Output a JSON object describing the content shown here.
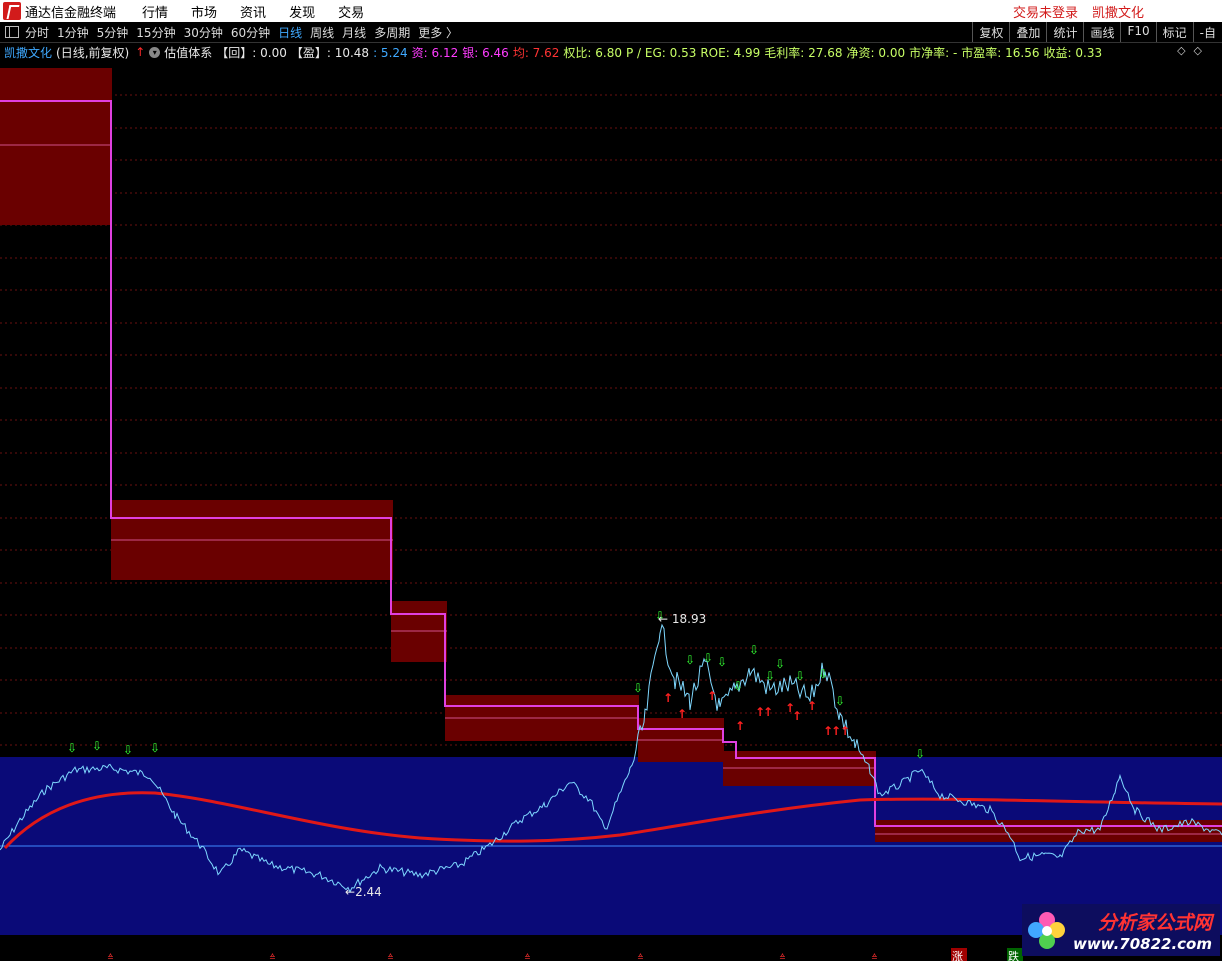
{
  "titlebar": {
    "app_title": "通达信金融终端",
    "menu": [
      "行情",
      "市场",
      "资讯",
      "发现",
      "交易"
    ],
    "login_status": "交易未登录",
    "stock": "凯撒文化"
  },
  "toolbar": {
    "periods": [
      "分时",
      "1分钟",
      "5分钟",
      "15分钟",
      "30分钟",
      "60分钟",
      "日线",
      "周线",
      "月线",
      "多周期",
      "更多 〉"
    ],
    "active_period": "日线",
    "right_buttons": [
      "复权",
      "叠加",
      "统计",
      "画线",
      "F10",
      "标记",
      "-自"
    ]
  },
  "infobar": {
    "stock_name": "凯撒文化",
    "mode": "(日线,前复权)",
    "indicator": "估值体系",
    "items": [
      {
        "label": "【回】: 0.00",
        "color": "#e8e8e8"
      },
      {
        "label": "【盈】: 10.48",
        "color": "#e8e8e8"
      },
      {
        "label": ": 5.24",
        "color": "#3fa9ff"
      },
      {
        "label": "资: 6.12",
        "color": "#ff3cff"
      },
      {
        "label": "银: 6.46",
        "color": "#ff3cff"
      },
      {
        "label": "均: 7.62",
        "color": "#ff3333"
      },
      {
        "label": "权比: 6.80",
        "color": "#c8ff66"
      },
      {
        "label": "P / EG: 0.53",
        "color": "#c8ff66"
      },
      {
        "label": "ROE: 4.99",
        "color": "#c8ff66"
      },
      {
        "label": "毛利率: 27.68",
        "color": "#c8ff66"
      },
      {
        "label": "净资: 0.00",
        "color": "#c8ff66"
      },
      {
        "label": "市净率: -",
        "color": "#c8ff66"
      },
      {
        "label": "市盈率: 16.56",
        "color": "#c8ff66"
      },
      {
        "label": "收益: 0.33",
        "color": "#c8ff66"
      }
    ]
  },
  "chart": {
    "high_label": "18.93",
    "low_label": "2.44",
    "bottom_up_label": "涨",
    "bottom_down_label": "跌",
    "colors": {
      "background": "#000000",
      "band": "#0a0a78",
      "box_fill": "#6a0000",
      "step_line": "#e040e0",
      "ma_line": "#e01818",
      "price": "#7fd8ff",
      "up_signal": "#33ff33",
      "down_signal": "#ff2020"
    }
  },
  "watermark": {
    "name": "分析家公式网",
    "url": "www.70822.com"
  }
}
